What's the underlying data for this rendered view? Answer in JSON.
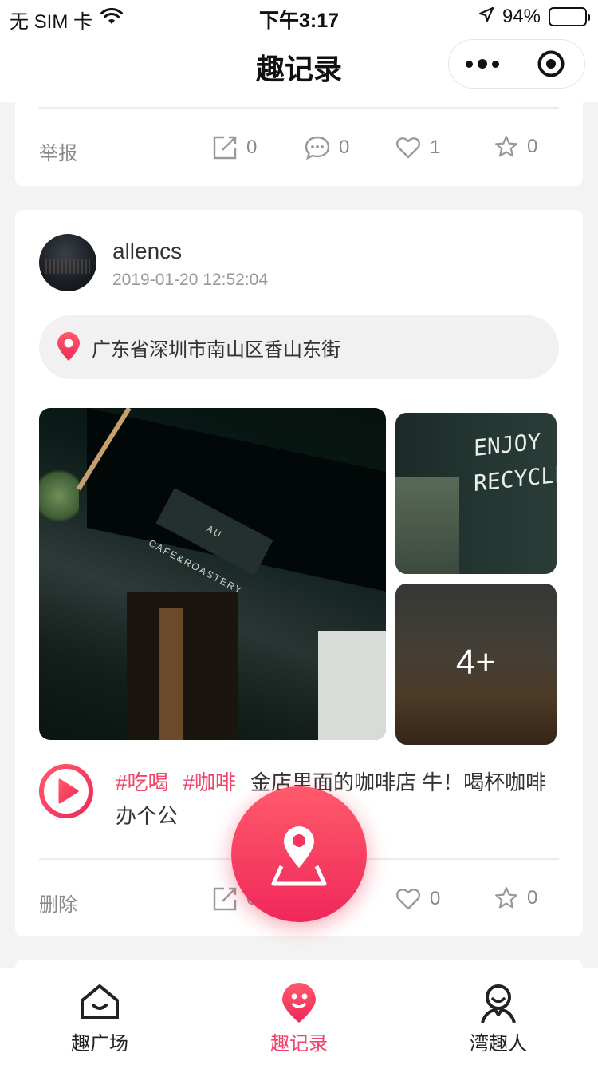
{
  "status_bar": {
    "carrier": "无 SIM 卡",
    "time": "下午3:17",
    "battery": "94%",
    "battery_level": 0.94
  },
  "nav": {
    "title": "趣记录"
  },
  "previous_post": {
    "report_label": "举报",
    "share_count": "0",
    "comment_count": "0",
    "like_count": "1",
    "favorite_count": "0"
  },
  "post": {
    "username": "allencs",
    "timestamp": "2019-01-20 12:52:04",
    "location": "广东省深圳市南山区香山东街",
    "photos": {
      "main_sign_text": "AU CAFE&ROASTERY",
      "side_sign_line1": "ENJOY",
      "side_sign_line2": "RECYCLE!",
      "more_count": "4+"
    },
    "tags": [
      "#吃喝",
      "#咖啡"
    ],
    "text": "金店里面的咖啡店 牛！喝杯咖啡办个公",
    "delete_label": "删除",
    "share_count": "0",
    "like_count": "0",
    "favorite_count": "0"
  },
  "tab_bar": {
    "items": [
      {
        "label": "趣广场",
        "icon": "house-smile-icon"
      },
      {
        "label": "趣记录",
        "icon": "location-face-icon"
      },
      {
        "label": "湾趣人",
        "icon": "person-icon"
      }
    ],
    "active_index": 1
  },
  "colors": {
    "accent": "#f0446a",
    "fab_top": "#ff5a6b",
    "fab_bottom": "#f0285a"
  }
}
